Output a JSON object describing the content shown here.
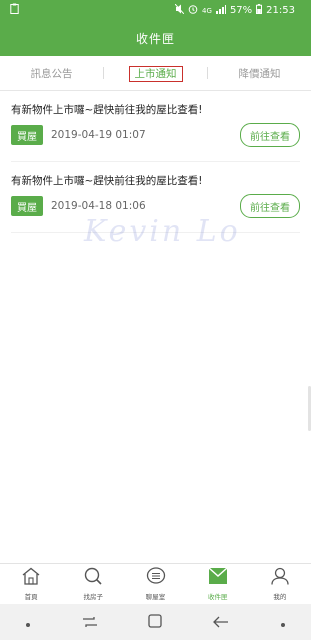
{
  "status": {
    "battery": "57%",
    "time": "21:53",
    "network": "4G"
  },
  "header": {
    "title": "收件匣"
  },
  "tabs": [
    {
      "label": "訊息公告"
    },
    {
      "label": "上市通知"
    },
    {
      "label": "降價通知"
    }
  ],
  "messages": [
    {
      "title": "有新物件上市囉~趕快前往我的屋比查看!",
      "badge": "買屋",
      "time": "2019-04-19 01:07",
      "action": "前往查看"
    },
    {
      "title": "有新物件上市囉~趕快前往我的屋比查看!",
      "badge": "買屋",
      "time": "2019-04-18 01:06",
      "action": "前往查看"
    }
  ],
  "watermark": "Kevin Lo",
  "nav": [
    {
      "label": "首頁",
      "icon": "home-icon"
    },
    {
      "label": "找房子",
      "icon": "search-icon"
    },
    {
      "label": "聊屋室",
      "icon": "chat-icon"
    },
    {
      "label": "收件匣",
      "icon": "mail-icon"
    },
    {
      "label": "我的",
      "icon": "user-icon"
    }
  ],
  "colors": {
    "brand": "#5aac4a",
    "highlight": "#c9302c"
  }
}
